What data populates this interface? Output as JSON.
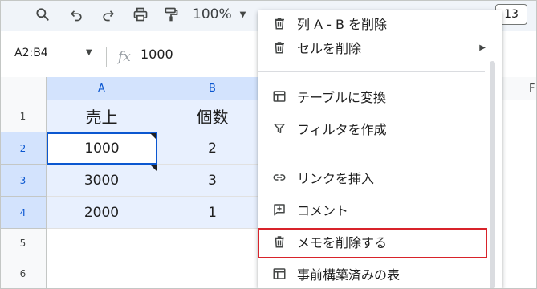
{
  "toolbar": {
    "icons": [
      "search-icon",
      "undo-icon",
      "redo-icon",
      "print-icon",
      "paint-format-icon"
    ],
    "zoom": "100%",
    "font_size": "13"
  },
  "formula_bar": {
    "name_box": "A2:B4",
    "fx_label": "fx",
    "value": "1000"
  },
  "grid": {
    "columns": [
      {
        "label": "A",
        "selected": true
      },
      {
        "label": "B",
        "selected": true
      }
    ],
    "partial_column_label": "F",
    "rows": [
      {
        "num": "1",
        "cells": [
          "売上",
          "個数"
        ],
        "selected": false
      },
      {
        "num": "2",
        "cells": [
          "1000",
          "2"
        ],
        "selected": true
      },
      {
        "num": "3",
        "cells": [
          "3000",
          "3"
        ],
        "selected": true
      },
      {
        "num": "4",
        "cells": [
          "2000",
          "1"
        ],
        "selected": true
      },
      {
        "num": "5",
        "cells": [
          "",
          ""
        ],
        "selected": false
      },
      {
        "num": "6",
        "cells": [
          "",
          ""
        ],
        "selected": false
      }
    ],
    "active_cell": "A2"
  },
  "context_menu": {
    "items": [
      {
        "label": "列 A - B を削除",
        "icon": "trash-icon"
      },
      {
        "label": "セルを削除",
        "icon": "trash-icon",
        "has_submenu": true
      },
      {
        "label": "テーブルに変換",
        "icon": "table-icon"
      },
      {
        "label": "フィルタを作成",
        "icon": "filter-icon"
      },
      {
        "label": "リンクを挿入",
        "icon": "link-icon"
      },
      {
        "label": "コメント",
        "icon": "comment-add-icon"
      },
      {
        "label": "メモを削除する",
        "icon": "trash-icon",
        "highlighted": true
      },
      {
        "label": "事前構築済みの表",
        "icon": "table-icon"
      }
    ],
    "submenu_arrow": "▶",
    "highlight_color": "#d8232a"
  },
  "colors": {
    "selection_header": "#d3e3fd",
    "selection_fill": "#e8f0fe",
    "active_border": "#0b57d0",
    "toolbar_bg": "#f0f4f9"
  }
}
